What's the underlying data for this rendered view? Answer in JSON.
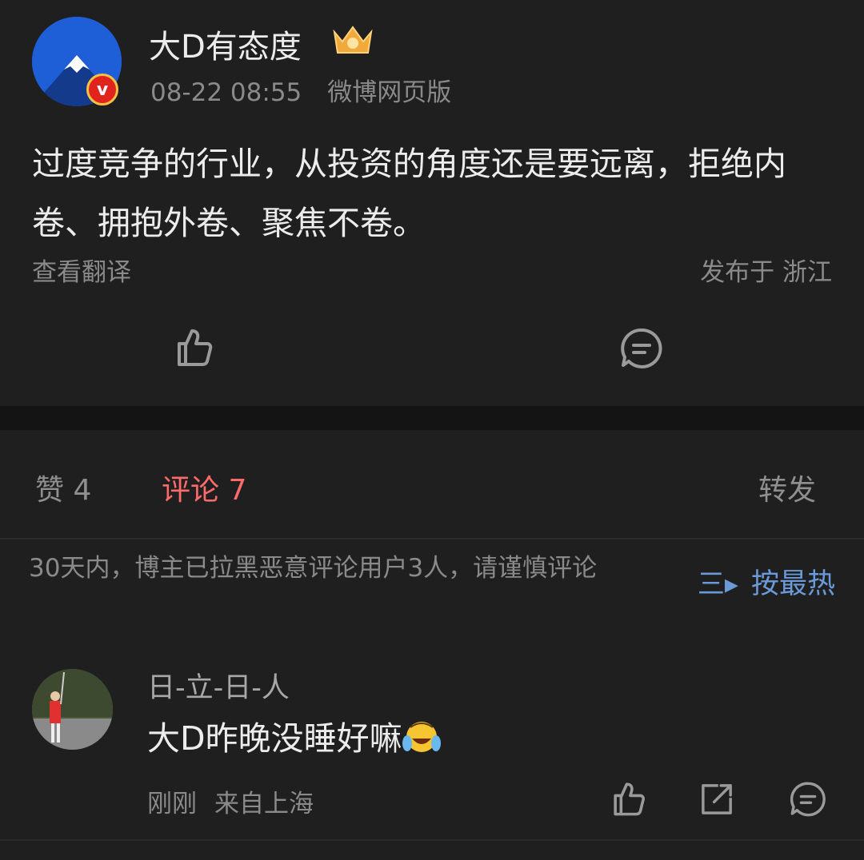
{
  "post": {
    "author": "大D有态度",
    "badge_letter": "v",
    "time": "08-22 08:55",
    "source": "微博网页版",
    "content": "过度竞争的行业，从投资的角度还是要远离，拒绝内卷、拥抱外卷、聚焦不卷。",
    "translate_label": "查看翻译",
    "location": "发布于 浙江"
  },
  "tabs": [
    {
      "label": "赞 4"
    },
    {
      "label": "评论 7"
    },
    {
      "label": "转发"
    }
  ],
  "notice": "30天内，博主已拉黑恶意评论用户3人，请谨慎评论",
  "sort_label": "按最热",
  "sort_icon": "三▸",
  "comment": {
    "name": "日-立-日-人",
    "text": "大D昨晚没睡好嘛",
    "time": "刚刚",
    "location": "来自上海"
  },
  "colors": {
    "background": "#1f1f1f",
    "accent_red": "#ff6b6b",
    "link_blue": "#6a9ad8",
    "badge_red": "#e0231d"
  }
}
